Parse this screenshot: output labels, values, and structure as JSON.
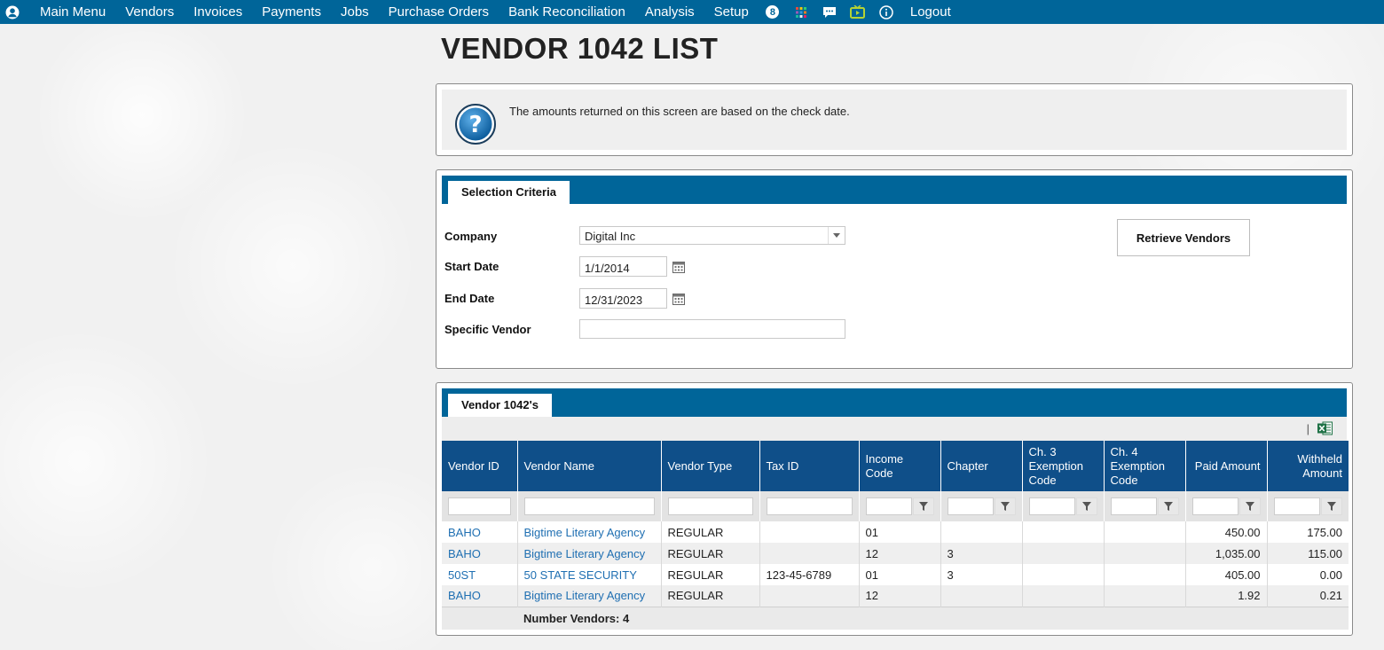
{
  "nav": {
    "items": [
      "Main Menu",
      "Vendors",
      "Invoices",
      "Payments",
      "Jobs",
      "Purchase Orders",
      "Bank Reconciliation",
      "Analysis",
      "Setup"
    ],
    "badge": "8",
    "logout": "Logout",
    "icons": [
      "user-icon",
      "badge-icon",
      "apps-grid-icon",
      "chat-icon",
      "tv-icon",
      "info-icon"
    ]
  },
  "page": {
    "title": "VENDOR 1042 LIST"
  },
  "info": {
    "message": "The amounts returned on this screen are based on the check date."
  },
  "criteria": {
    "tab": "Selection Criteria",
    "company_label": "Company",
    "company_value": "Digital Inc",
    "start_label": "Start Date",
    "start_value": "1/1/2014",
    "end_label": "End Date",
    "end_value": "12/31/2023",
    "vendor_label": "Specific Vendor",
    "vendor_value": "",
    "retrieve_button": "Retrieve Vendors"
  },
  "grid": {
    "tab": "Vendor 1042's",
    "separator": "|",
    "columns": [
      "Vendor ID",
      "Vendor Name",
      "Vendor Type",
      "Tax ID",
      "Income Code",
      "Chapter",
      "Ch. 3 Exemption Code",
      "Ch. 4 Exemption Code",
      "Paid Amount",
      "Withheld Amount"
    ],
    "rows": [
      [
        "BAHO",
        "Bigtime Literary Agency",
        "REGULAR",
        "",
        "01",
        "",
        "",
        "",
        "450.00",
        "175.00"
      ],
      [
        "BAHO",
        "Bigtime Literary Agency",
        "REGULAR",
        "",
        "12",
        "3",
        "",
        "",
        "1,035.00",
        "115.00"
      ],
      [
        "50ST",
        "50 STATE SECURITY",
        "REGULAR",
        "123-45-6789",
        "01",
        "3",
        "",
        "",
        "405.00",
        "0.00"
      ],
      [
        "BAHO",
        "Bigtime Literary Agency",
        "REGULAR",
        "",
        "12",
        "",
        "",
        "",
        "1.92",
        "0.21"
      ]
    ],
    "footer": "Number Vendors: 4"
  },
  "colors": {
    "nav": "#006599",
    "header": "#0f4f89",
    "link": "#1f6fb2"
  }
}
